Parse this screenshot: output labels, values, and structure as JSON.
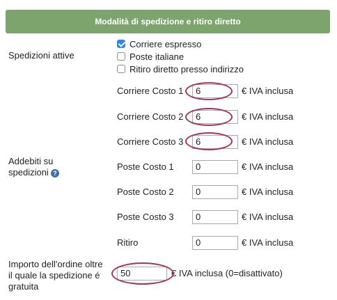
{
  "header": {
    "title": "Modalità di spedizione e ritiro diretto"
  },
  "spedizioni_attive": {
    "label": "Spedizioni attive",
    "options": [
      {
        "label": "Corriere espresso",
        "checked": true
      },
      {
        "label": "Poste italiane",
        "checked": false
      },
      {
        "label": "Ritiro diretto presso indirizzo",
        "checked": false
      }
    ]
  },
  "addebiti": {
    "label_line1": "Addebiti su",
    "label_line2": "spedizioni",
    "rows": [
      {
        "label": "Corriere Costo 1",
        "value": "6",
        "unit": "€ IVA inclusa"
      },
      {
        "label": "Corriere Costo 2",
        "value": "6",
        "unit": "€ IVA inclusa"
      },
      {
        "label": "Corriere Costo 3",
        "value": "6",
        "unit": "€ IVA inclusa"
      },
      {
        "label": "Poste Costo 1",
        "value": "0",
        "unit": "€ IVA inclusa"
      },
      {
        "label": "Poste Costo 2",
        "value": "0",
        "unit": "€ IVA inclusa"
      },
      {
        "label": "Poste Costo 3",
        "value": "0",
        "unit": "€ IVA inclusa"
      },
      {
        "label": "Ritiro",
        "value": "0",
        "unit": "€ IVA inclusa"
      }
    ]
  },
  "gratuita": {
    "label_line1": "Importo dell'ordine oltre",
    "label_line2": "il quale la spedizione é",
    "label_line3": "gratuita",
    "value": "50",
    "unit": "€ IVA inclusa (0=disattivato)"
  },
  "colors": {
    "header_bg": "#7ea46d",
    "highlight_ring": "#a3335a",
    "checkbox_checked": "#2d86f0"
  }
}
